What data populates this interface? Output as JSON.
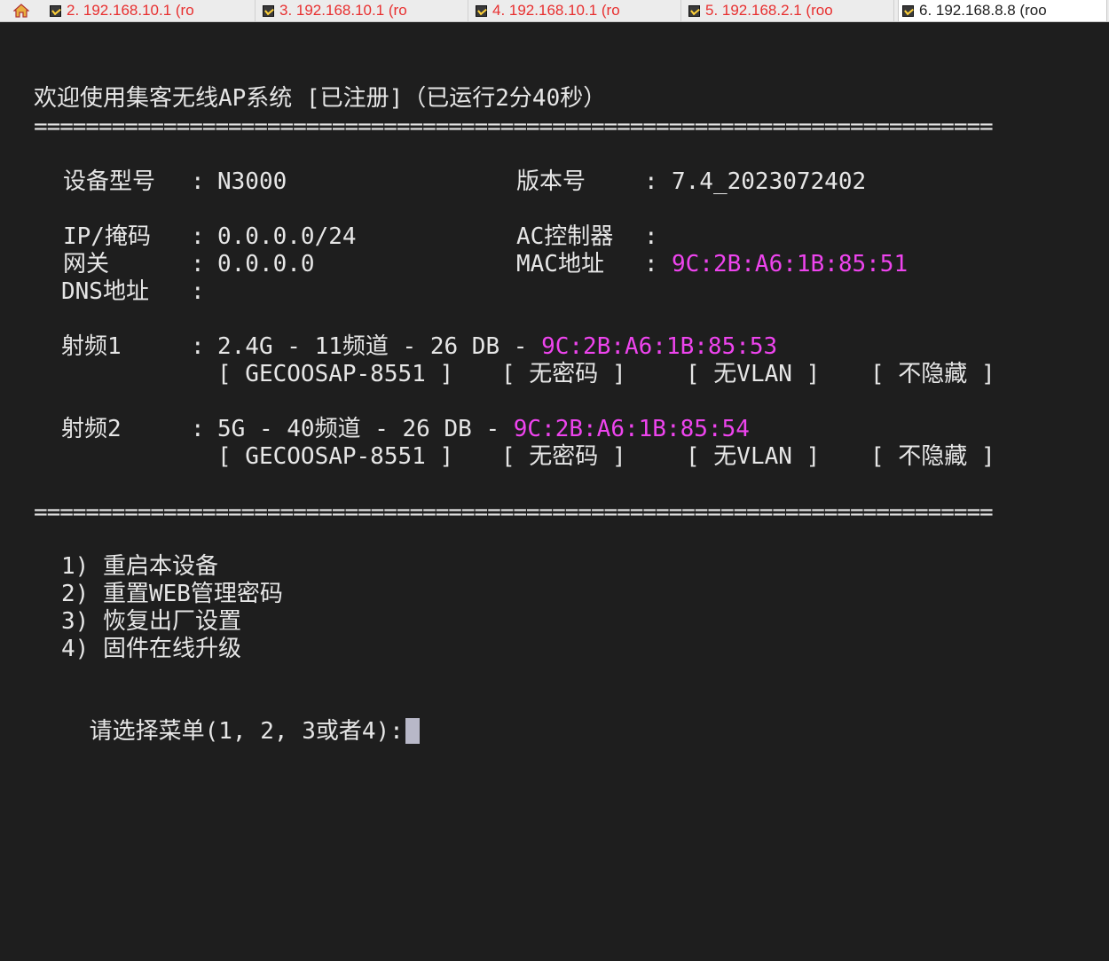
{
  "tabs": [
    {
      "label": "2. 192.168.10.1 (ro"
    },
    {
      "label": "3. 192.168.10.1 (ro"
    },
    {
      "label": "4. 192.168.10.1 (ro"
    },
    {
      "label": "5. 192.168.2.1 (roo"
    },
    {
      "label": "6. 192.168.8.8 (roo"
    }
  ],
  "terminal": {
    "title": "欢迎使用集客无线AP系统 [已注册]（已运行2分40秒）",
    "rule": "==========================================================================",
    "model_label": "设备型号",
    "model_value": "N3000",
    "version_label": "版本号",
    "version_value": "7.4_2023072402",
    "ip_label": "IP/掩码",
    "ip_value": "0.0.0.0/24",
    "ac_label": "AC控制器",
    "gateway_label": "网关",
    "gateway_value": "0.0.0.0",
    "mac_label": "MAC地址",
    "mac_value": "9C:2B:A6:1B:85:51",
    "dns_label": "DNS地址",
    "sep": ":",
    "radio1_label": "射频1",
    "radio1_info": "2.4G - 11频道 - 26 DB - ",
    "radio1_mac": "9C:2B:A6:1B:85:53",
    "radio1_ssid": "[ GECOOSAP-8551 ]",
    "radio1_pass": "[ 无密码 ]",
    "radio1_vlan": "[ 无VLAN ]",
    "radio1_hide": "[ 不隐藏 ]",
    "radio2_label": "射频2",
    "radio2_info": "5G - 40频道 - 26 DB - ",
    "radio2_mac": "9C:2B:A6:1B:85:54",
    "radio2_ssid": "[ GECOOSAP-8551 ]",
    "radio2_pass": "[ 无密码 ]",
    "radio2_vlan": "[ 无VLAN ]",
    "radio2_hide": "[ 不隐藏 ]",
    "menu": [
      "1) 重启本设备",
      "2) 重置WEB管理密码",
      "3) 恢复出厂设置",
      "4) 固件在线升级"
    ],
    "prompt": "请选择菜单(1, 2, 3或者4):"
  },
  "colors": {
    "background": "#1e1e1e",
    "text": "#e6e6e6",
    "mac_highlight": "#ee44ee",
    "inactive_tab_text": "#e83030"
  }
}
